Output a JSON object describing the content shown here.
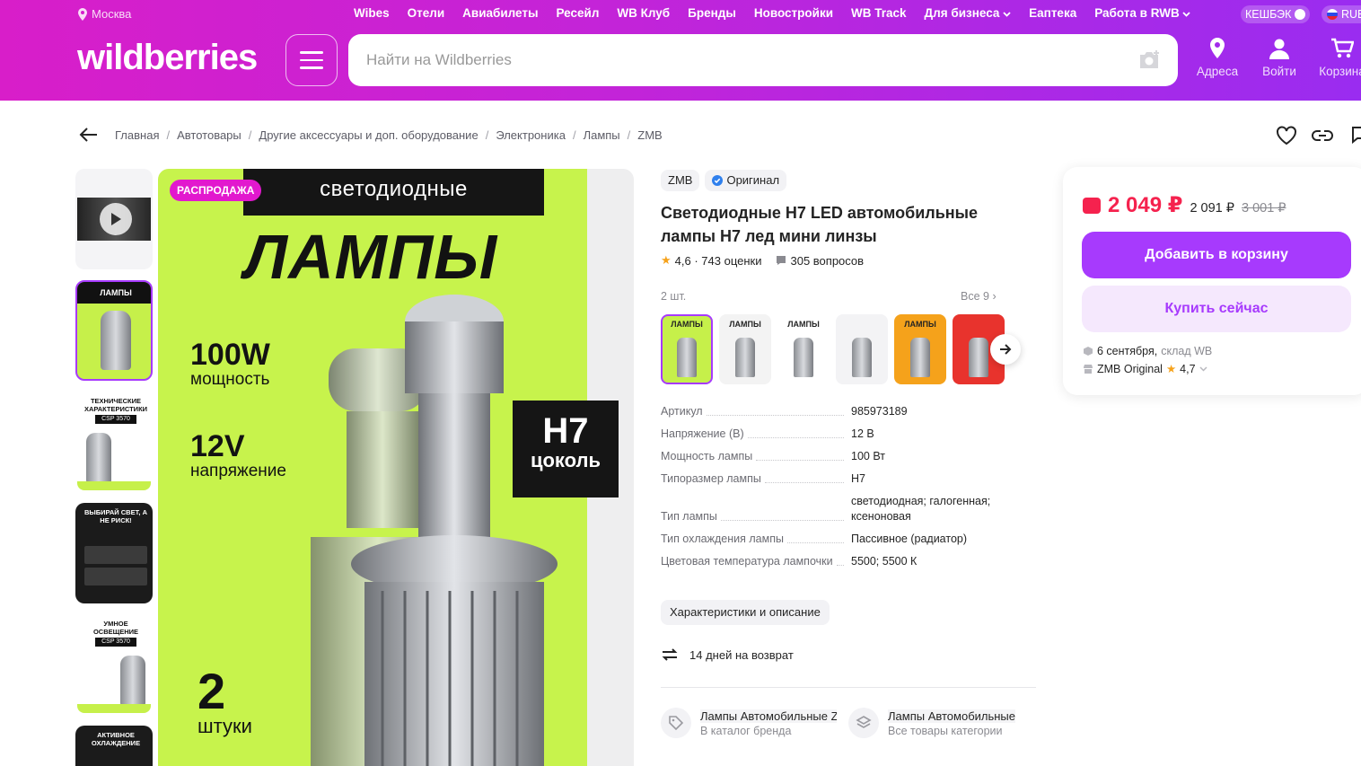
{
  "header": {
    "city": "Москва",
    "nav_links": [
      "Wibes",
      "Отели",
      "Авиабилеты",
      "Ресейл",
      "WB Клуб",
      "Бренды",
      "Новостройки",
      "WB Track",
      "Для бизнеса",
      "Еаптека",
      "Работа в RWB"
    ],
    "cashback": "КЕШБЭК",
    "lang": "RUB",
    "logo": "wildberries",
    "search_placeholder": "Найти на Wildberries",
    "addresses": "Адреса",
    "login": "Войти",
    "cart": "Корзина"
  },
  "breadcrumbs": [
    "Главная",
    "Автотовары",
    "Другие аксессуары и доп. оборудование",
    "Электроника",
    "Лампы",
    "ZMB"
  ],
  "thumbs": {
    "t2_title": "ЛАМПЫ",
    "t3_title": "ТЕХНИЧЕСКИЕ ХАРАКТЕРИСТИКИ",
    "t3_chip": "CSP 3570",
    "t4_title": "ВЫБИРАЙ СВЕТ, А НЕ РИСК!",
    "t5_title": "УМНОЕ ОСВЕЩЕНИЕ",
    "t5_chip": "CSP 3570",
    "t6_title": "АКТИВНОЕ ОХЛАЖДЕНИЕ"
  },
  "main_image": {
    "sale_badge": "РАСПРОДАЖА",
    "top_band": "светодиодные",
    "headline": "ЛАМПЫ",
    "power_big": "100W",
    "power_small": "мощность",
    "voltage_big": "12V",
    "voltage_small": "напряжение",
    "base_big": "H7",
    "base_small": "цоколь",
    "count_big": "2",
    "count_small": "штуки"
  },
  "product": {
    "brand": "ZMB",
    "original": "Оригинал",
    "title": "Светодиодные H7 LED автомобильные лампы H7 лед мини линзы",
    "rating": "4,6 · 743 оценки",
    "questions": "305 вопросов",
    "qty_label": "2 шт.",
    "all_label": "Все 9",
    "variants": [
      {
        "label": "ЛАМПЫ",
        "bg": "#c6f04a"
      },
      {
        "label": "ЛАМПЫ",
        "bg": "#f3f3f3"
      },
      {
        "label": "ЛАМПЫ",
        "bg": "#ffffff"
      },
      {
        "label": "",
        "bg": "#f3f3f5"
      },
      {
        "label": "ЛАМПЫ",
        "bg": "#f5a21b"
      },
      {
        "label": "",
        "bg": "#e8332d"
      }
    ],
    "params": [
      {
        "k": "Артикул",
        "v": "985973189"
      },
      {
        "k": "Напряжение (В)",
        "v": "12 В"
      },
      {
        "k": "Мощность лампы",
        "v": "100 Вт"
      },
      {
        "k": "Типоразмер лампы",
        "v": "H7"
      },
      {
        "k": "Тип лампы",
        "v": "светодиодная; галогенная; ксеноновая"
      },
      {
        "k": "Тип охлаждения лампы",
        "v": "Пассивное (радиатор)"
      },
      {
        "k": "Цветовая температура лампочки",
        "v": "5500; 5500 К"
      }
    ],
    "desc_button": "Характеристики и описание",
    "return": "14 дней на возврат",
    "cat1_title": "Лампы Автомобильные Z",
    "cat1_sub": "В каталог бренда",
    "cat2_title": "Лампы Автомобильные",
    "cat2_sub": "Все товары категории"
  },
  "buy": {
    "price": "2 049 ₽",
    "price_wallet": "2 091 ₽",
    "price_old": "3 001 ₽",
    "add_to_cart": "Добавить в корзину",
    "buy_now": "Купить сейчас",
    "delivery_date": "6 сентября,",
    "delivery_wh": "склад WB",
    "seller": "ZMB Original",
    "seller_rating": "4,7"
  },
  "colors": {
    "accent": "#a73afd",
    "price": "#f5224e",
    "header_start": "#d81ec9",
    "header_end": "#9a2cf0"
  }
}
